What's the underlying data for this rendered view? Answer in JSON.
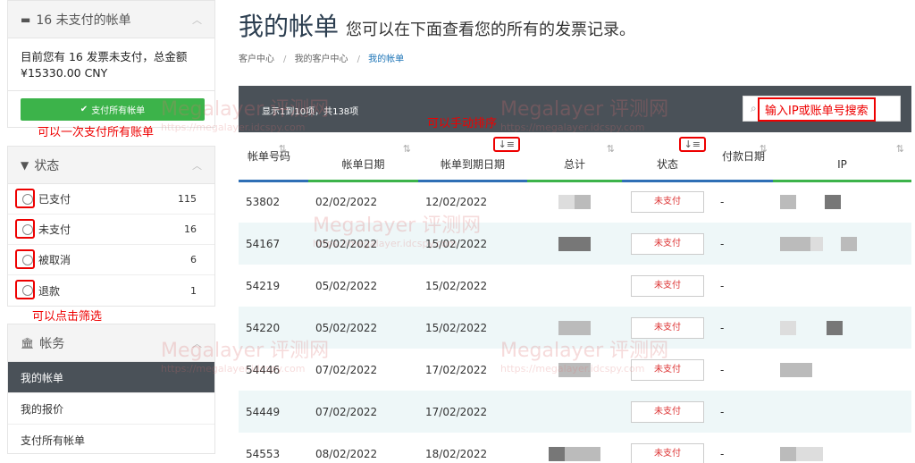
{
  "sidebar": {
    "unpaid_panel": {
      "title": "16 未支付的帐单",
      "message": "目前您有 16 发票未支付，总金额 ¥15330.00 CNY",
      "pay_all_label": "支付所有帐单"
    },
    "status_panel": {
      "title": "状态",
      "items": [
        {
          "label": "已支付",
          "count": "115"
        },
        {
          "label": "未支付",
          "count": "16"
        },
        {
          "label": "被取消",
          "count": "6"
        },
        {
          "label": "退款",
          "count": "1"
        }
      ]
    },
    "account_panel": {
      "title": "帐务",
      "items": [
        {
          "label": "我的帐单"
        },
        {
          "label": "我的报价"
        },
        {
          "label": "支付所有帐单"
        }
      ]
    }
  },
  "annotations": {
    "pay_all": "可以一次支付所有账单",
    "filter": "可以点击筛选",
    "sort": "可以手动排序",
    "search": "输入IP或账单号搜索"
  },
  "main": {
    "title": "我的帐单",
    "subtitle": "您可以在下面查看您的所有的发票记录。",
    "breadcrumbs": [
      "客户中心",
      "我的客户中心",
      "我的帐单"
    ],
    "table_info": "显示1到10项，共138项",
    "columns": [
      "帐单号码",
      "帐单日期",
      "帐单到期日期",
      "总计",
      "状态",
      "付款日期",
      "IP"
    ],
    "rows": [
      {
        "id": "53802",
        "date": "02/02/2022",
        "due": "12/02/2022",
        "status": "未支付",
        "paid": "-"
      },
      {
        "id": "54167",
        "date": "05/02/2022",
        "due": "15/02/2022",
        "status": "未支付",
        "paid": "-"
      },
      {
        "id": "54219",
        "date": "05/02/2022",
        "due": "15/02/2022",
        "status": "未支付",
        "paid": "-"
      },
      {
        "id": "54220",
        "date": "05/02/2022",
        "due": "15/02/2022",
        "status": "未支付",
        "paid": "-"
      },
      {
        "id": "54446",
        "date": "07/02/2022",
        "due": "17/02/2022",
        "status": "未支付",
        "paid": "-"
      },
      {
        "id": "54449",
        "date": "07/02/2022",
        "due": "17/02/2022",
        "status": "未支付",
        "paid": "-"
      },
      {
        "id": "54553",
        "date": "08/02/2022",
        "due": "18/02/2022",
        "status": "未支付",
        "paid": "-"
      }
    ]
  },
  "watermark": {
    "brand": "Megalayer 评测网",
    "url": "https://megalayer.idcspy.com"
  }
}
